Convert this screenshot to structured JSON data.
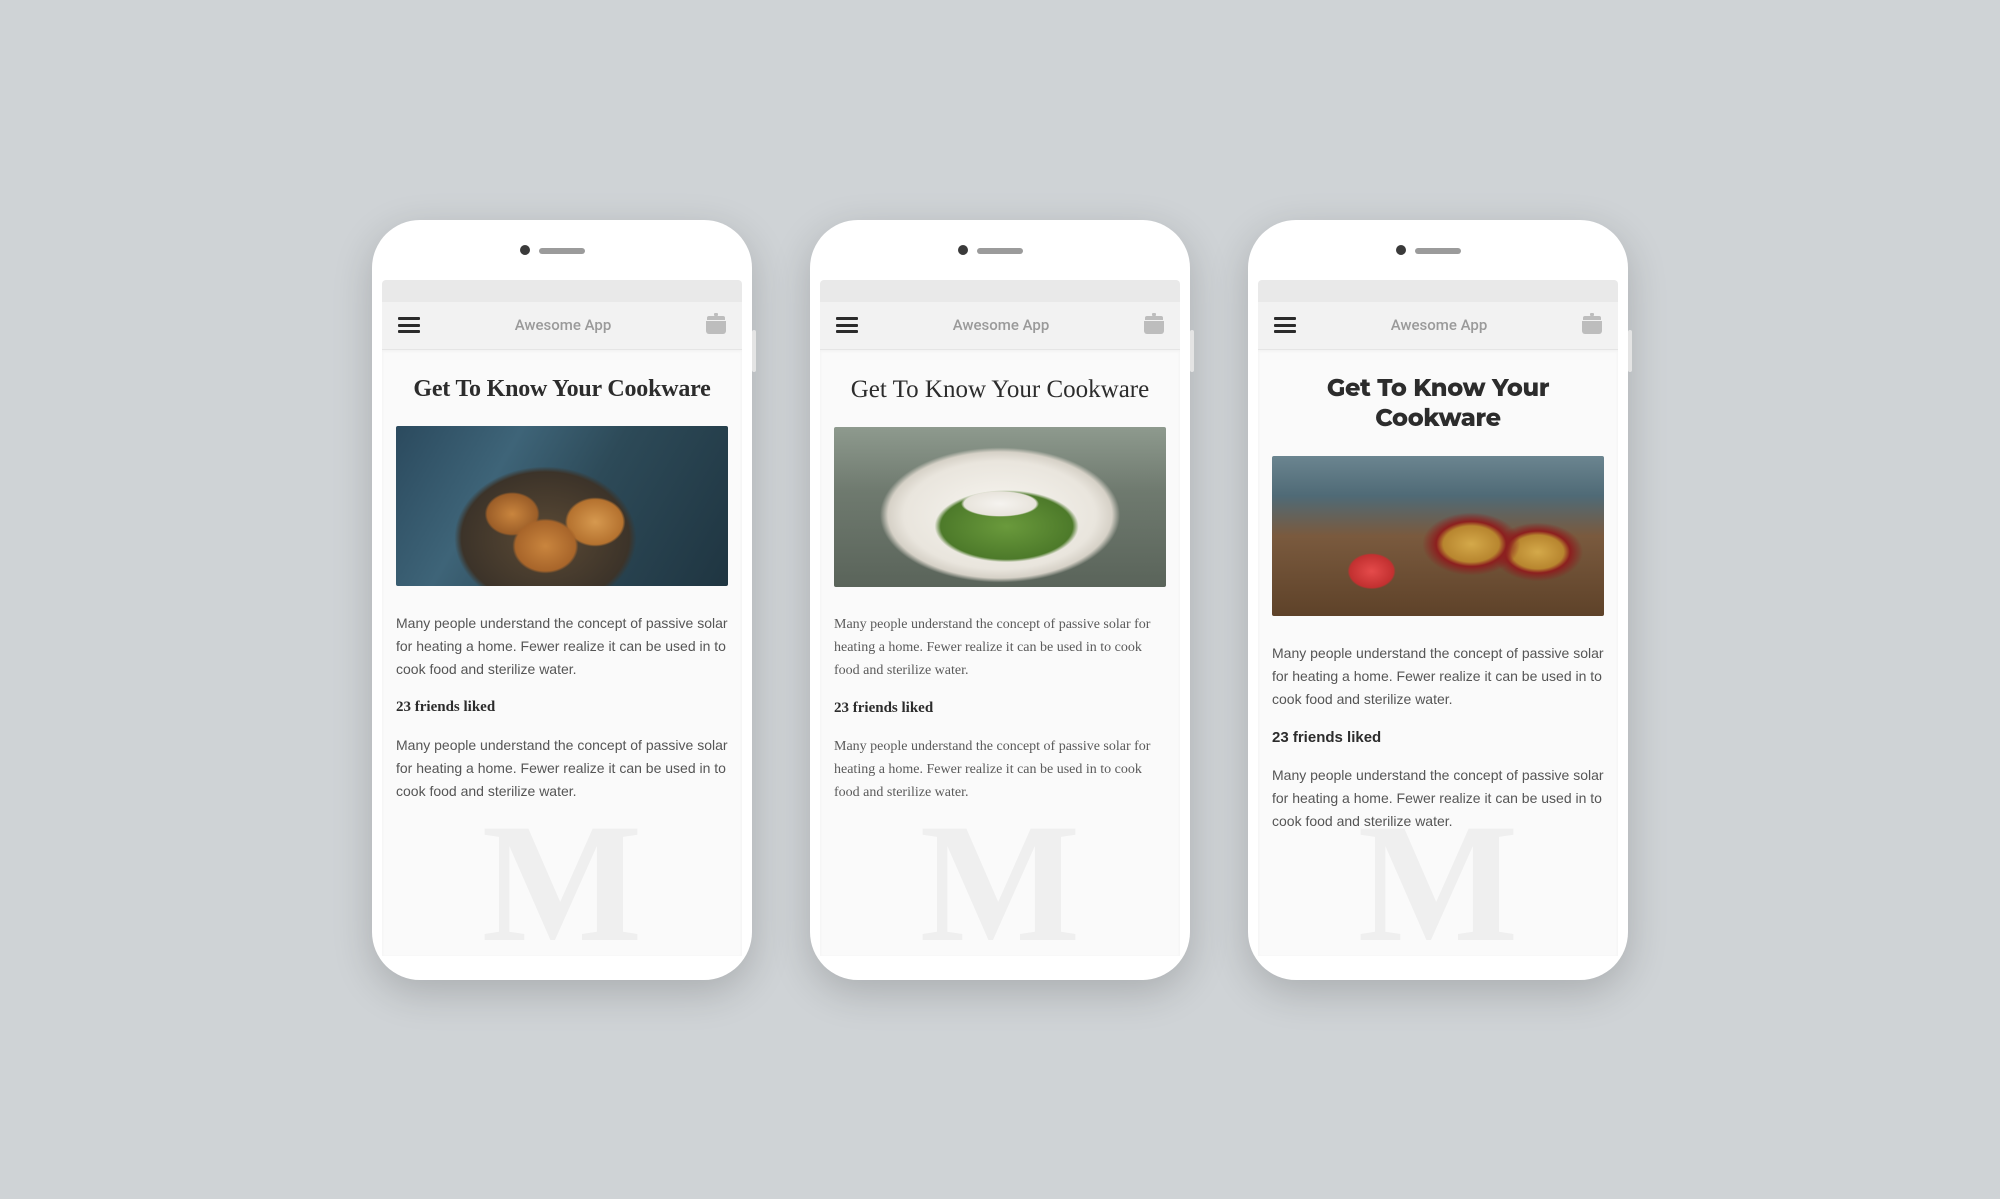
{
  "header": {
    "app_title": "Awesome App"
  },
  "article": {
    "title": "Get To Know Your Cookware",
    "paragraph_1": "Many people understand the concept of passive solar for heating a home. Fewer realize it can be used in to cook food and sterilize water.",
    "friends_liked": "23 friends liked",
    "paragraph_2": "Many people understand the concept of passive solar for heating a home. Fewer realize it can be used in to cook food and sterilize water."
  },
  "watermark": "M",
  "variants": [
    "slab-serif",
    "classic-serif",
    "geometric-sans"
  ]
}
